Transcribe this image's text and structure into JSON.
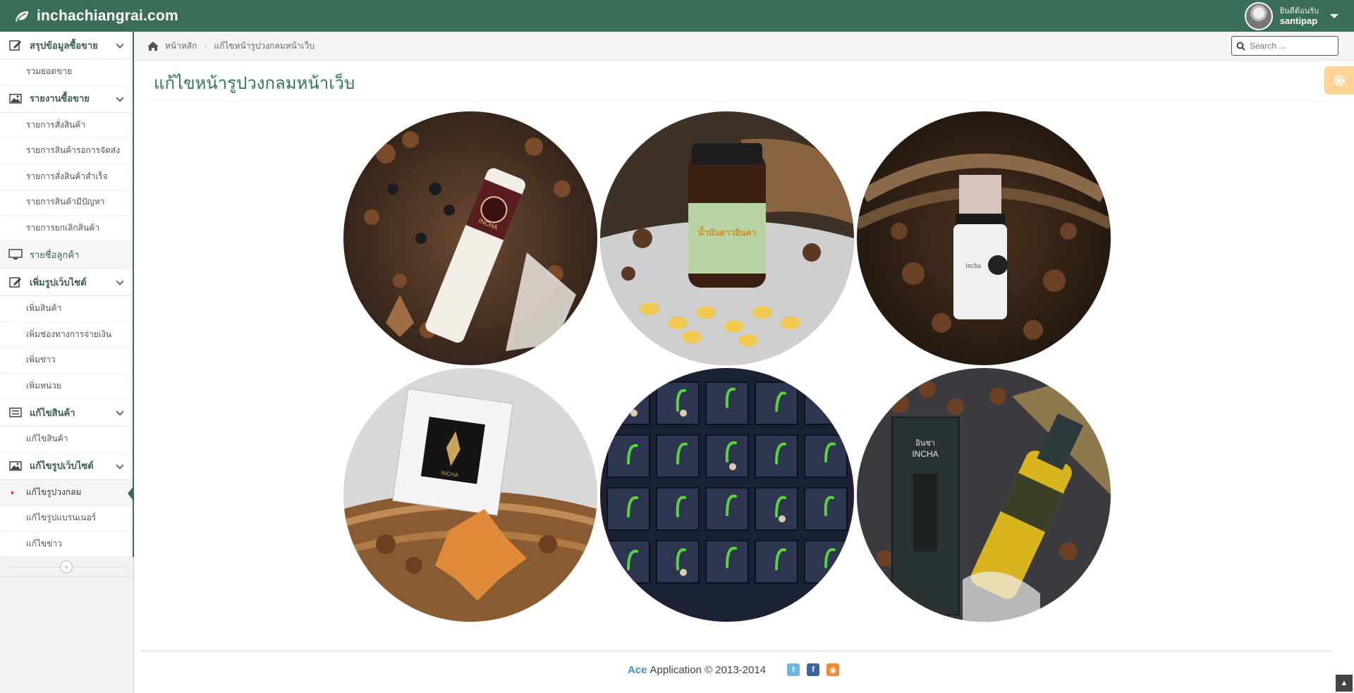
{
  "brand": {
    "name": "inchachiangrai.com",
    "icon": "leaf-icon"
  },
  "user": {
    "welcome": "ยินดีต้อนรับ",
    "name": "santipap"
  },
  "sidebar": {
    "groups": [
      {
        "label": "สรุปข้อมูลซื้อขาย",
        "icon": "edit-icon",
        "items": [
          {
            "label": "รวมยอดขาย"
          }
        ]
      },
      {
        "label": "รายงานซื้อขาย",
        "icon": "picture-icon",
        "items": [
          {
            "label": "รายการสั่งสินค้า"
          },
          {
            "label": "รายการสินค้ารอการจัดส่ง"
          },
          {
            "label": "รายการสั่งสินค้าสำเร็จ"
          },
          {
            "label": "รายการสินค้ามีปัญหา"
          },
          {
            "label": "รายการยกเลิกสินค้า"
          }
        ]
      },
      {
        "label": "รายชื่อลูกค้า",
        "icon": "desktop-icon",
        "items": []
      },
      {
        "label": "เพิ่มรูปเว็บไซต์",
        "icon": "edit-icon",
        "items": [
          {
            "label": "เพิ่มสินค้า"
          },
          {
            "label": "เพิ่มช่องทางการจ่ายเงิน"
          },
          {
            "label": "เพิ่มข่าว"
          },
          {
            "label": "เพิ่มหน่วย"
          }
        ]
      },
      {
        "label": "แก้ไขสินค้า",
        "icon": "list-icon",
        "items": [
          {
            "label": "แก้ไขสินค้า"
          }
        ]
      },
      {
        "label": "แก้ไขรูปเว็บไซต์",
        "icon": "picture-icon",
        "items": [
          {
            "label": "แก้ไขรูปวงกลม",
            "active": true
          },
          {
            "label": "แก้ไขรูปแบรนเนอร์"
          },
          {
            "label": "แก้ไขข่าว"
          }
        ]
      }
    ]
  },
  "breadcrumb": {
    "home": "หน้าหลัก",
    "current": "แก้ไขหน้ารูปวงกลมหน้าเว็บ"
  },
  "search": {
    "placeholder": "Search ..."
  },
  "page": {
    "title": "แก้ไขหน้ารูปวงกลมหน้าเว็บ",
    "arrow": "»"
  },
  "gallery": {
    "images": [
      {
        "name": "body-lotion-tube-image"
      },
      {
        "name": "sacha-inchi-capsules-image"
      },
      {
        "name": "serum-bottle-image"
      },
      {
        "name": "soap-box-image"
      },
      {
        "name": "seedlings-image"
      },
      {
        "name": "incha-oil-bottle-image"
      }
    ],
    "labels": {
      "tube": "INCHA",
      "jar": "น้ำมันดาวอินคา",
      "serum": "incha",
      "box": "INCHA",
      "oil": "INCHA",
      "oil_brand": "อินชา"
    }
  },
  "footer": {
    "ace": "Ace",
    "text": "Application © 2013-2014"
  },
  "colors": {
    "navbar": "#3b6e58",
    "title": "#2e7a4f",
    "settings": "#ffb752"
  }
}
